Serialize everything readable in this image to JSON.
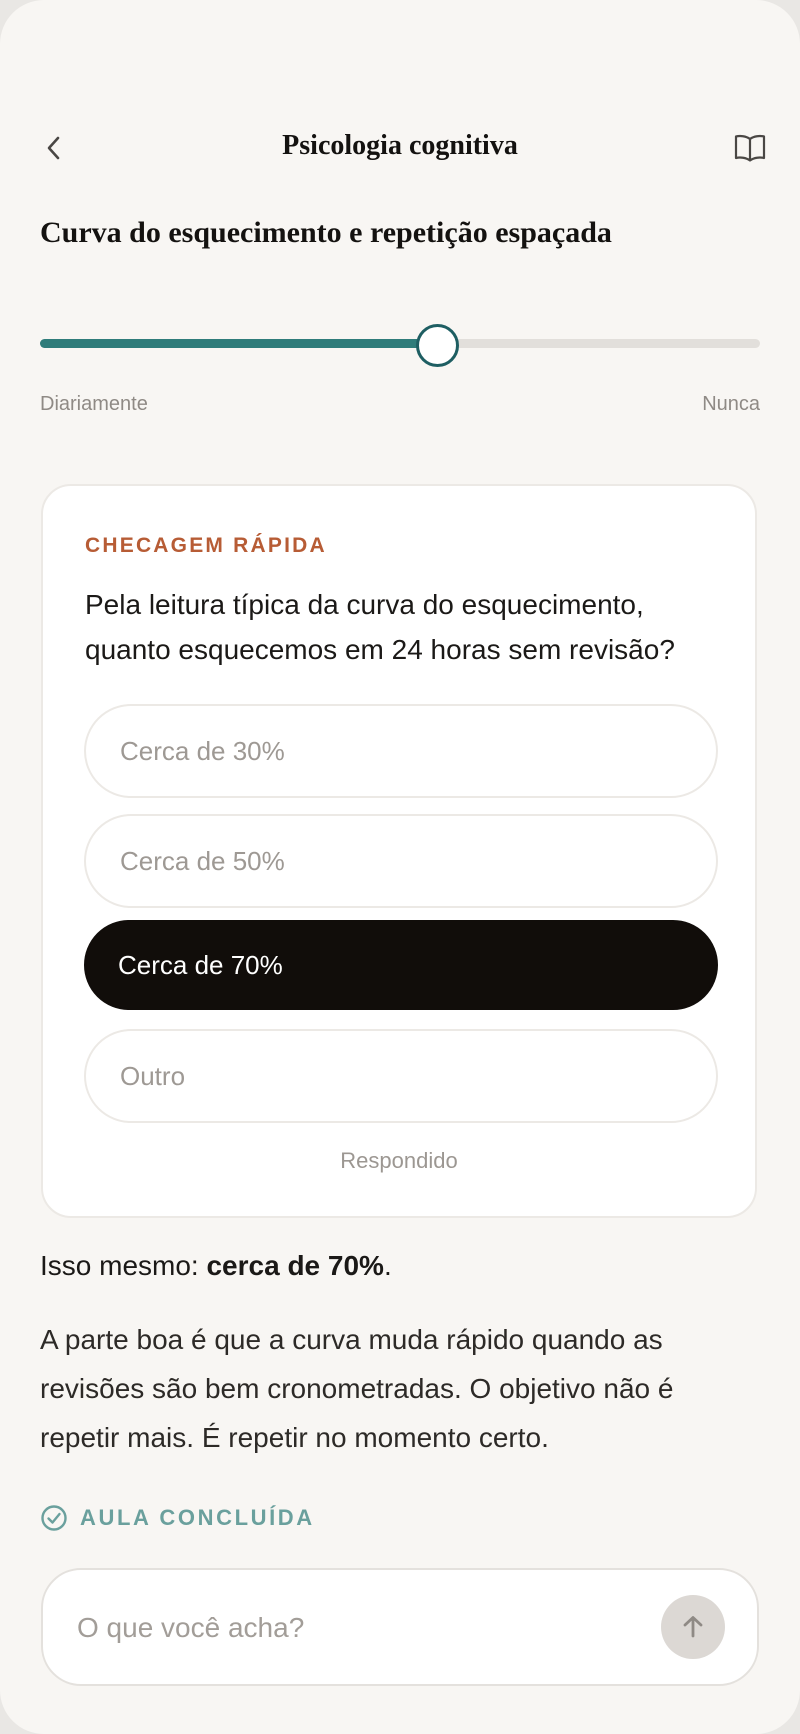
{
  "header": {
    "back_icon": "chevron-left-icon",
    "title": "Psicologia cognitiva",
    "book_icon": "book-icon"
  },
  "lesson": {
    "title": "Curva do esquecimento e repetição espaçada"
  },
  "slider": {
    "value": 0.55,
    "min_label": "Diariamente",
    "max_label": "Nunca"
  },
  "quiz": {
    "eyebrow": "CHECAGEM RÁPIDA",
    "question": "Pela leitura típica da curva do esquecimento, quanto esquecemos em 24 horas sem revisão?",
    "options": [
      {
        "label": "Cerca de 30%",
        "selected": false
      },
      {
        "label": "Cerca de 50%",
        "selected": false
      },
      {
        "label": "Cerca de 70%",
        "selected": true
      },
      {
        "label": "Outro",
        "selected": false
      }
    ],
    "status": "Respondido"
  },
  "feedback": {
    "prefix": "Isso mesmo: ",
    "highlight": "cerca de 70%",
    "suffix": "."
  },
  "explanation": "A parte boa é que a curva muda rápido quando as revisões são bem cronometradas. O objetivo não é repetir mais. É repetir no momento certo.",
  "completion": {
    "icon": "check-circle-icon",
    "label": "AULA CONCLUÍDA"
  },
  "composer": {
    "placeholder": "O que você acha?",
    "send_icon": "arrow-up-icon"
  },
  "colors": {
    "accent": "#2f7c7a",
    "eyebrow": "#b75c35",
    "selected_option": "#110d0a",
    "background": "#f8f6f3"
  }
}
